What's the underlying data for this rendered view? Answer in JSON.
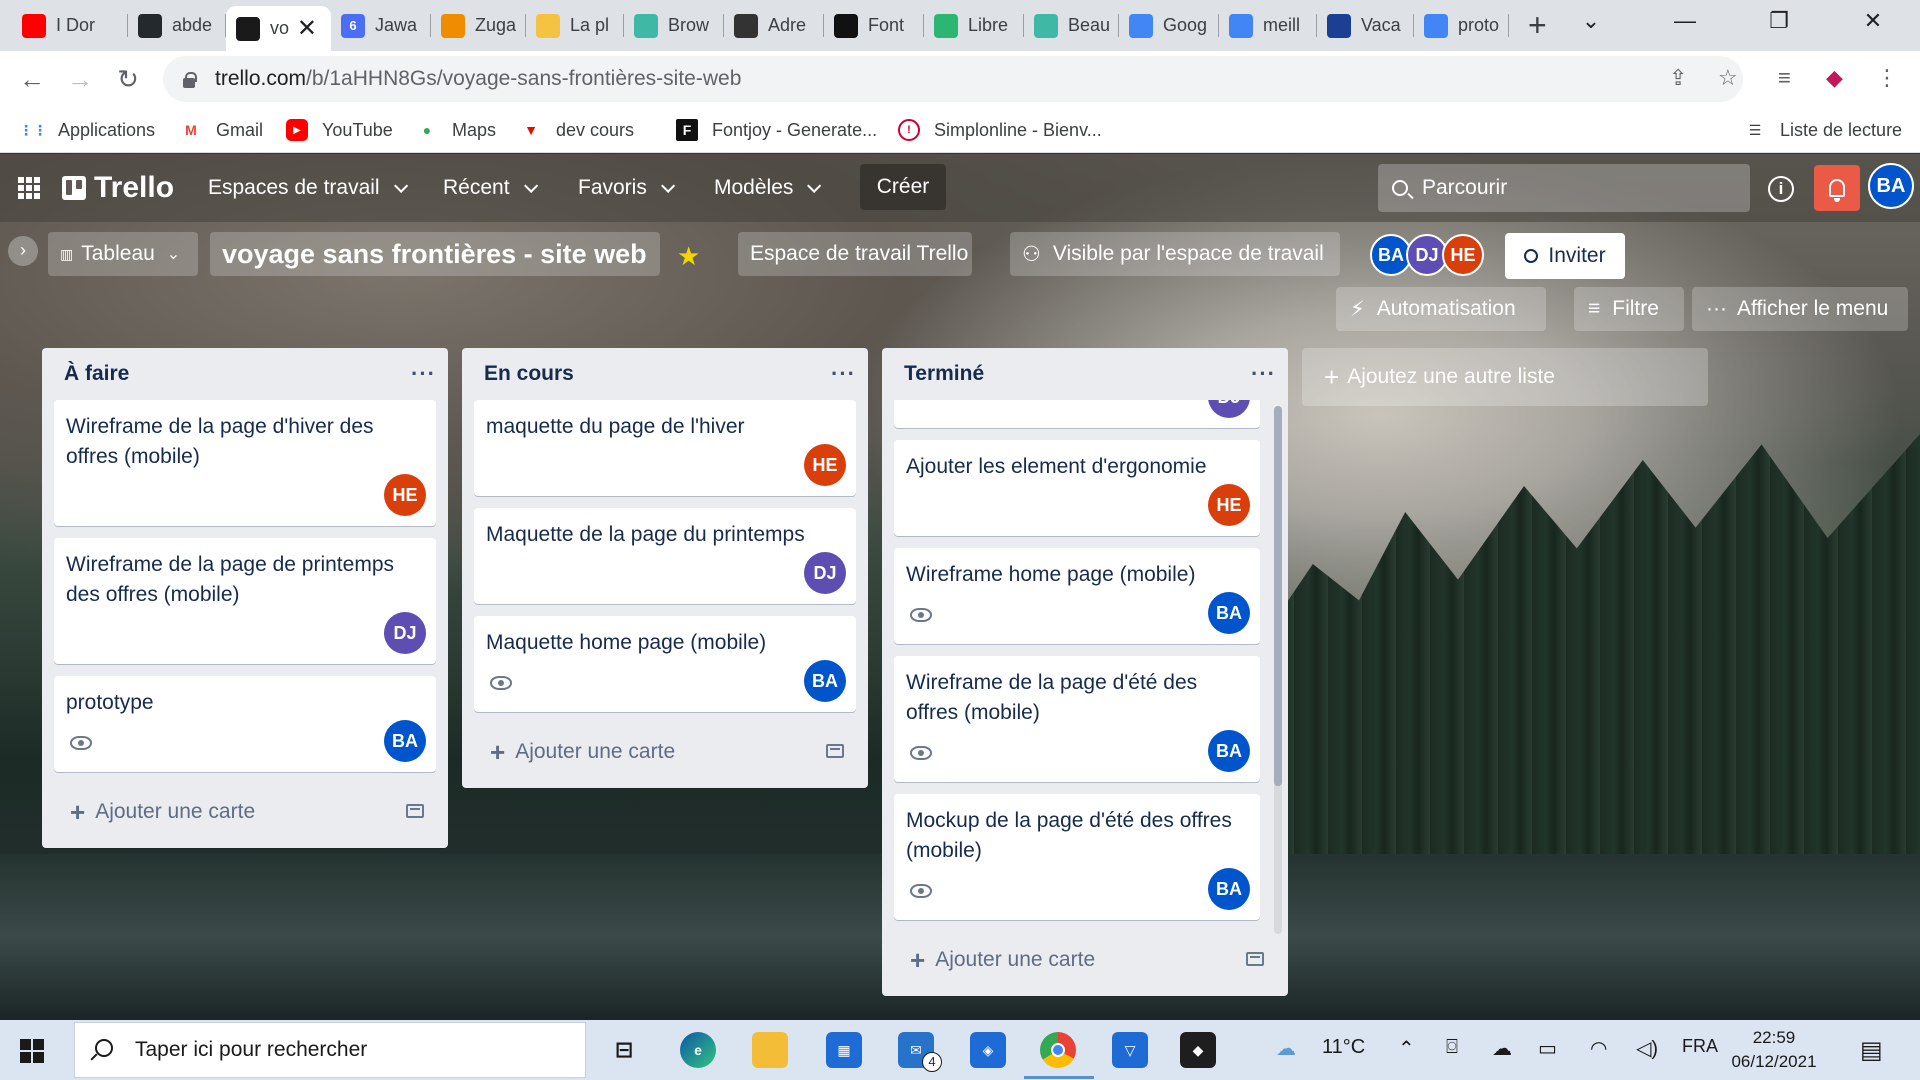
{
  "browser": {
    "tabs": [
      {
        "label": "I Dor",
        "color": "#ff0000",
        "icon": "youtube-icon"
      },
      {
        "label": "abde",
        "color": "#24292e",
        "icon": "github-icon"
      },
      {
        "label": "vo",
        "color": "#1a1a1a",
        "icon": "trello-icon",
        "active": true
      },
      {
        "label": "Jawa",
        "color": "#4c6ef5",
        "icon": "notification-icon"
      },
      {
        "label": "Zuga",
        "color": "#f08c00",
        "icon": "zuga-icon"
      },
      {
        "label": "La pl",
        "color": "#f5c242",
        "icon": "binance-icon"
      },
      {
        "label": "Brow",
        "color": "#3fb9a6",
        "icon": "page-icon"
      },
      {
        "label": "Adre",
        "color": "#333333",
        "icon": "script-icon"
      },
      {
        "label": "Font",
        "color": "#111111",
        "icon": "fontjoy-icon"
      },
      {
        "label": "Libre",
        "color": "#2bb673",
        "icon": "libre-icon"
      },
      {
        "label": "Beau",
        "color": "#3fb9a6",
        "icon": "page-icon"
      },
      {
        "label": "Goog",
        "color": "#4285f4",
        "icon": "translate-icon"
      },
      {
        "label": "meill",
        "color": "#4285f4",
        "icon": "google-icon"
      },
      {
        "label": "Vaca",
        "color": "#1c3f94",
        "icon": "vacation-icon"
      },
      {
        "label": "proto",
        "color": "#4285f4",
        "icon": "google-icon"
      }
    ],
    "tab_badge": "6",
    "url_host": "trello.com",
    "url_path": "/b/1aHHN8Gs/voyage-sans-frontières-site-web",
    "bookmarks": [
      {
        "label": "Applications",
        "icon": "apps-grid-icon"
      },
      {
        "label": "Gmail",
        "icon": "gmail-icon"
      },
      {
        "label": "YouTube",
        "icon": "youtube-icon"
      },
      {
        "label": "Maps",
        "icon": "maps-icon"
      },
      {
        "label": "dev cours",
        "icon": "dev-icon"
      },
      {
        "label": "Fontjoy - Generate...",
        "icon": "fontjoy-icon"
      },
      {
        "label": "Simplonline - Bienv...",
        "icon": "simplon-icon"
      }
    ],
    "reading_list": "Liste de lecture"
  },
  "trello": {
    "logo": "Trello",
    "nav": [
      "Espaces de travail",
      "Récent",
      "Favoris",
      "Modèles"
    ],
    "create": "Créer",
    "search_placeholder": "Parcourir",
    "me": "BA"
  },
  "board": {
    "view": "Tableau",
    "title": "voyage sans frontières - site web",
    "workspace": "Espace de travail Trello",
    "visibility": "Visible par l'espace de travail",
    "members": [
      {
        "initials": "BA",
        "color": "#0055cc"
      },
      {
        "initials": "DJ",
        "color": "#5e4db2"
      },
      {
        "initials": "HE",
        "color": "#d93f0b"
      }
    ],
    "invite": "Inviter",
    "automation": "Automatisation",
    "filter": "Filtre",
    "menu": "Afficher le menu",
    "add_list": "Ajoutez une autre liste",
    "add_card": "Ajouter une carte",
    "lists": [
      {
        "title": "À faire",
        "cards": [
          {
            "text": "Wireframe de la page d'hiver des offres (mobile)",
            "member": "HE",
            "eye": false
          },
          {
            "text": "Wireframe de la page de printemps des offres (mobile)",
            "member": "DJ",
            "eye": false
          },
          {
            "text": "prototype",
            "member": "BA",
            "eye": true
          }
        ]
      },
      {
        "title": "En cours",
        "cards": [
          {
            "text": "maquette du page de l'hiver",
            "member": "HE",
            "eye": false
          },
          {
            "text": "Maquette de la page du printemps",
            "member": "DJ",
            "eye": false
          },
          {
            "text": "Maquette home page (mobile)",
            "member": "BA",
            "eye": true
          }
        ]
      },
      {
        "title": "Terminé",
        "cards": [
          {
            "text": "",
            "member": "DJ",
            "eye": false
          },
          {
            "text": "Ajouter les element d'ergonomie",
            "member": "HE",
            "eye": false
          },
          {
            "text": "Wireframe home page (mobile)",
            "member": "BA",
            "eye": true
          },
          {
            "text": "Wireframe de la page d'été des offres (mobile)",
            "member": "BA",
            "eye": true
          },
          {
            "text": "Mockup de la page d'été des offres (mobile)",
            "member": "BA",
            "eye": true
          }
        ]
      }
    ]
  },
  "taskbar": {
    "search_placeholder": "Taper ici pour rechercher",
    "mail_badge": "4",
    "temperature": "11°C",
    "language": "FRA",
    "time": "22:59",
    "date": "06/12/2021"
  }
}
